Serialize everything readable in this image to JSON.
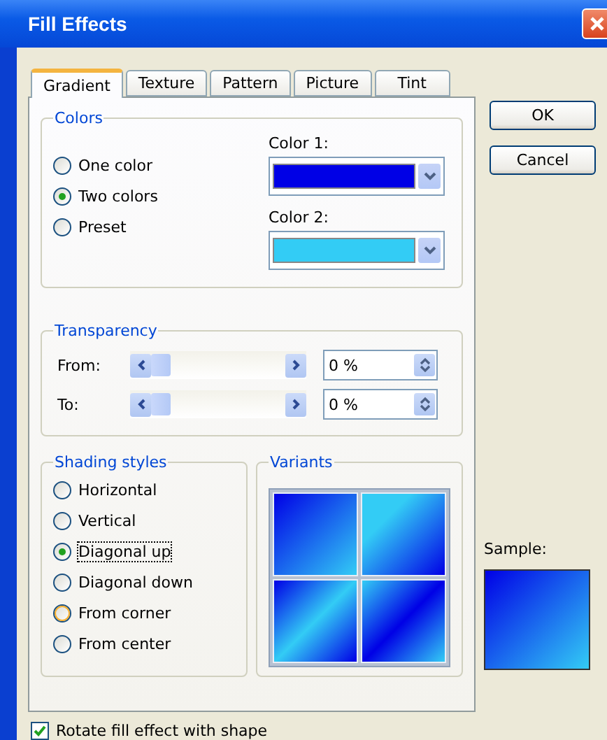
{
  "window": {
    "title": "Fill Effects"
  },
  "tabs": [
    {
      "label": "Gradient",
      "selected": true
    },
    {
      "label": "Texture",
      "selected": false
    },
    {
      "label": "Pattern",
      "selected": false
    },
    {
      "label": "Picture",
      "selected": false
    },
    {
      "label": "Tint",
      "selected": false
    }
  ],
  "buttons": [
    "OK",
    "Cancel"
  ],
  "colors": {
    "title": "Colors",
    "options": [
      {
        "label": "One color",
        "selected": false
      },
      {
        "label": "Two colors",
        "selected": true
      },
      {
        "label": "Preset",
        "selected": false
      }
    ],
    "pickers": [
      {
        "label": "Color 1:",
        "color": "#0000e6"
      },
      {
        "label": "Color 2:",
        "color": "#33ccf5"
      }
    ]
  },
  "transparency": {
    "title": "Transparency",
    "rows": [
      {
        "label": "From:",
        "level": 0,
        "value": "0 %"
      },
      {
        "label": "To:",
        "level": 0,
        "value": "0 %"
      }
    ]
  },
  "shading_styles": {
    "title": "Shading styles",
    "options": [
      {
        "label": "Horizontal",
        "selected": false,
        "hovered": false
      },
      {
        "label": "Vertical",
        "selected": false,
        "hovered": false
      },
      {
        "label": "Diagonal up",
        "selected": true,
        "hovered": false
      },
      {
        "label": "Diagonal down",
        "selected": false,
        "hovered": false
      },
      {
        "label": "From corner",
        "selected": false,
        "hovered": true
      },
      {
        "label": "From center",
        "selected": false,
        "hovered": false
      }
    ]
  },
  "variants": {
    "title": "Variants"
  },
  "sample": {
    "label": "Sample:"
  },
  "rotate_with_shape": {
    "label": "Rotate fill effect with shape",
    "checked": true
  }
}
